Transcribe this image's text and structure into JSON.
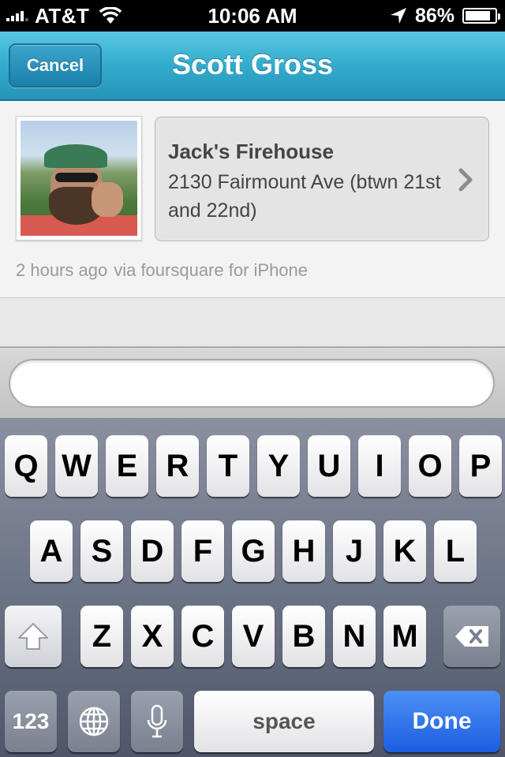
{
  "status_bar": {
    "carrier": "AT&T",
    "time": "10:06 AM",
    "battery_percent": "86%",
    "battery_level": 0.86
  },
  "nav": {
    "cancel_label": "Cancel",
    "title": "Scott Gross"
  },
  "checkin": {
    "venue_name": "Jack's Firehouse",
    "venue_address": "2130 Fairmount Ave (btwn 21st and 22nd)",
    "time_ago": "2 hours ago",
    "source": "via foursquare for iPhone"
  },
  "comment": {
    "value": "",
    "placeholder": ""
  },
  "keyboard": {
    "row1": [
      "Q",
      "W",
      "E",
      "R",
      "T",
      "Y",
      "U",
      "I",
      "O",
      "P"
    ],
    "row2": [
      "A",
      "S",
      "D",
      "F",
      "G",
      "H",
      "J",
      "K",
      "L"
    ],
    "row3": [
      "Z",
      "X",
      "C",
      "V",
      "B",
      "N",
      "M"
    ],
    "numbers_label": "123",
    "space_label": "space",
    "done_label": "Done"
  },
  "colors": {
    "nav_top": "#59c8e3",
    "nav_bottom": "#2594b8",
    "done_key": "#1c5ee0"
  }
}
